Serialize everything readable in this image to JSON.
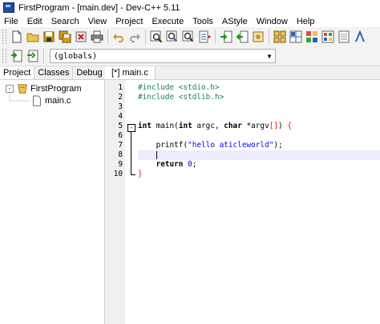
{
  "window": {
    "title": "FirstProgram - [main.dev] - Dev-C++ 5.11"
  },
  "menu": [
    "File",
    "Edit",
    "Search",
    "View",
    "Project",
    "Execute",
    "Tools",
    "AStyle",
    "Window",
    "Help"
  ],
  "toolbar2": {
    "scope_combo": "(globals)"
  },
  "left_panel": {
    "tabs": [
      "Project",
      "Classes",
      "Debug"
    ],
    "tree": {
      "project": "FirstProgram",
      "file": "main.c",
      "expander": "-"
    }
  },
  "editor": {
    "tab": "[*] main.c",
    "line_numbers": [
      "1",
      "2",
      "3",
      "4",
      "5",
      "6",
      "7",
      "8",
      "9",
      "10"
    ],
    "fold_marker": "-",
    "lines": {
      "l1": {
        "directive": "#include",
        "header": " <stdio.h>"
      },
      "l2": {
        "directive": "#include",
        "header": " <stdlib.h>"
      },
      "l5": {
        "kw1": "int",
        "name": " main(",
        "kw2": "int",
        "mid1": " argc, ",
        "kw3": "char",
        "mid2": " *argv",
        "brk": "[]",
        "close": ") ",
        "brace": "{"
      },
      "l7": {
        "indent": "    printf(",
        "string": "\"hello aticleworld\"",
        "end": ");"
      },
      "l9": {
        "indent": "    ",
        "kw": "return",
        "space": " ",
        "num": "0",
        "semi": ";"
      },
      "l10": {
        "brace": "}"
      }
    }
  },
  "colors": {
    "preprocessor": "#18835a",
    "string": "#0000ff",
    "brace": "#ff0000",
    "current_line": "#ececff"
  }
}
